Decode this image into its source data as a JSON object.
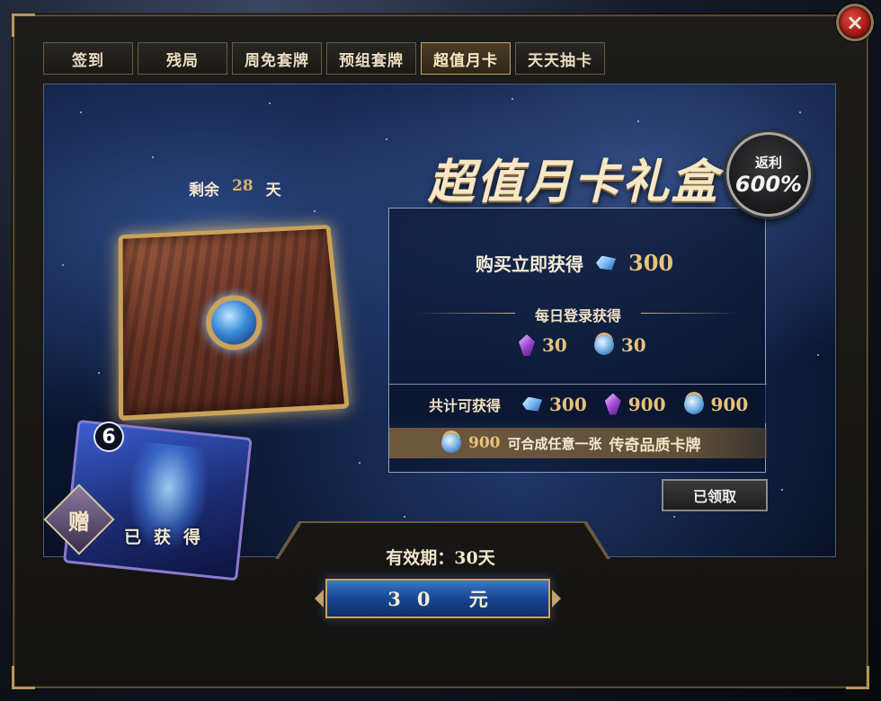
{
  "window": {
    "close_icon": "×"
  },
  "tabs": [
    {
      "label": "签到",
      "active": false
    },
    {
      "label": "残局",
      "active": false
    },
    {
      "label": "周免套牌",
      "active": false
    },
    {
      "label": "预组套牌",
      "active": false
    },
    {
      "label": "超值月卡",
      "active": true
    },
    {
      "label": "天天抽卡",
      "active": false
    }
  ],
  "banner": {
    "title": "超值月卡礼盒",
    "badge_top": "返利",
    "badge_value": "600%"
  },
  "remaining": {
    "prefix": "剩余",
    "days": "28",
    "suffix": "天"
  },
  "card": {
    "cost": "6",
    "gift_label": "赠",
    "status": "已获得"
  },
  "rewards": {
    "instant_label": "购买立即获得",
    "instant_value": "300",
    "daily_label": "每日登录获得",
    "daily_items": [
      {
        "icon": "purple-crystal-icon",
        "value": "30"
      },
      {
        "icon": "dust-orb-icon",
        "value": "30"
      }
    ],
    "total_label": "共计可获得",
    "total_items": [
      {
        "icon": "blue-gem-icon",
        "value": "300"
      },
      {
        "icon": "purple-crystal-icon",
        "value": "900"
      },
      {
        "icon": "dust-orb-icon",
        "value": "900"
      }
    ],
    "compose_value": "900",
    "compose_text": "可合成任意一张",
    "compose_highlight": "传奇品质卡牌"
  },
  "claim_button": "已领取",
  "validity": "有效期：30天",
  "price_button": "30 元",
  "colors": {
    "gold": "#c9a462",
    "value_gold": "#e8c27a",
    "panel_bg": "#0c1a3a",
    "price_blue": "#1a4a96"
  }
}
